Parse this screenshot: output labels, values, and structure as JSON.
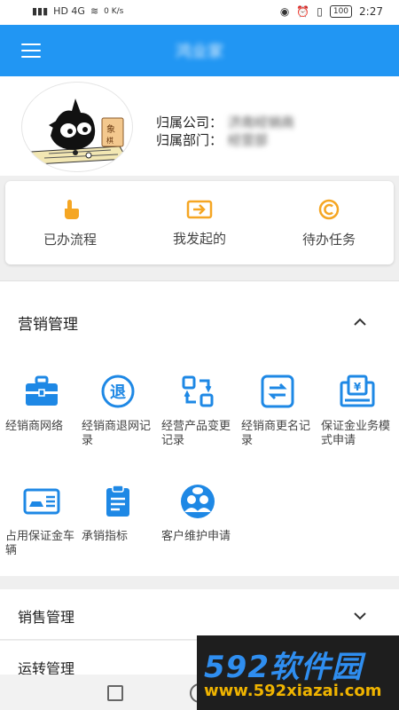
{
  "status_bar": {
    "left_text": "HD 4G",
    "speed": "0 K/s",
    "battery": "100",
    "time": "2:27"
  },
  "header": {
    "title": "鸿业家"
  },
  "profile": {
    "company_label": "归属公司：",
    "company_value": "济南经销商",
    "department_label": "归属部门：",
    "department_value": "经营部"
  },
  "quick_actions": [
    {
      "label": "已办流程",
      "icon": "hand-tap-icon"
    },
    {
      "label": "我发起的",
      "icon": "send-icon"
    },
    {
      "label": "待办任务",
      "icon": "copyright-icon"
    }
  ],
  "marketing": {
    "title": "营销管理",
    "items": [
      {
        "label": "经销商网络",
        "icon": "briefcase-icon"
      },
      {
        "label": "经销商退网记录",
        "icon": "withdraw-icon"
      },
      {
        "label": "经营产品变更记录",
        "icon": "exchange-icon"
      },
      {
        "label": "经销商更名记录",
        "icon": "rename-icon"
      },
      {
        "label": "保证金业务模式申请",
        "icon": "deposit-icon"
      },
      {
        "label": "占用保证金车辆",
        "icon": "car-card-icon"
      },
      {
        "label": "承销指标",
        "icon": "clipboard-icon"
      },
      {
        "label": "客户维护申请",
        "icon": "customers-icon"
      }
    ]
  },
  "sales": {
    "title": "销售管理"
  },
  "transport": {
    "title": "运转管理"
  },
  "watermark": {
    "brand": "592软件园",
    "url": "www.592xiazai.com"
  },
  "colors": {
    "primary": "#2196f3",
    "accent_orange": "#f5a623",
    "icon_blue": "#1e88e5"
  }
}
